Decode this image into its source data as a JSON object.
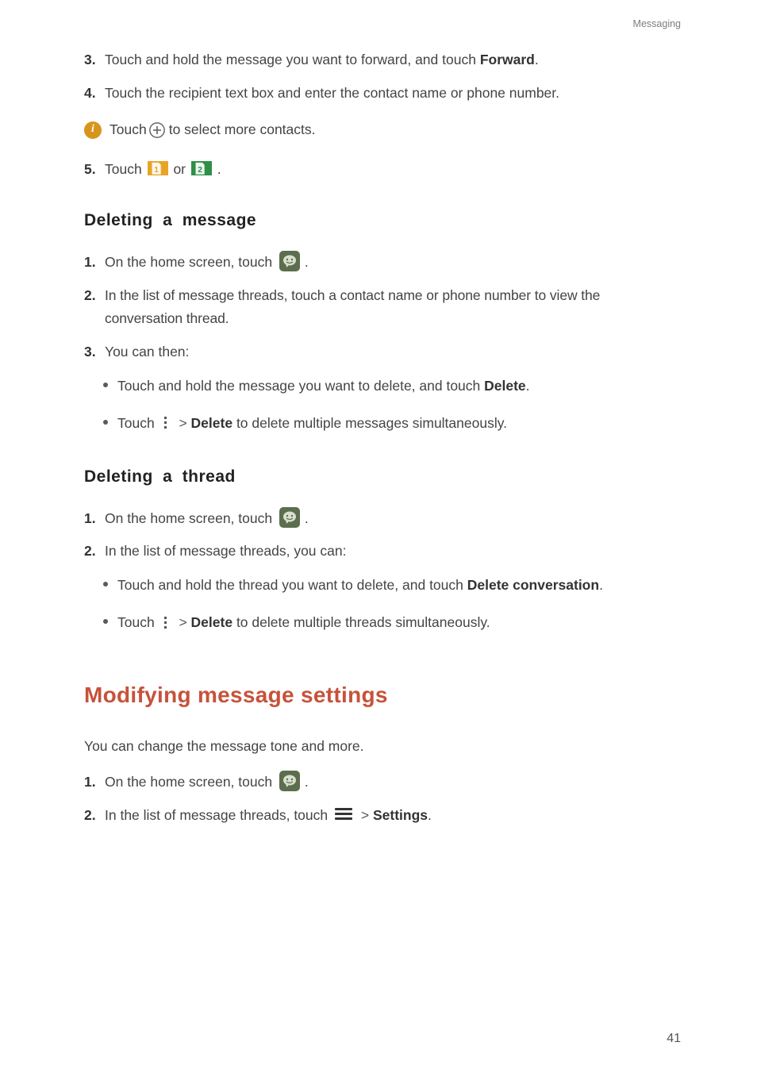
{
  "breadcrumb": "Messaging",
  "cont_steps": {
    "s3": {
      "num": "3.",
      "pre": "Touch and hold the message you want to forward, and touch ",
      "bold": "Forward",
      "post": "."
    },
    "s4": {
      "num": "4.",
      "text": "Touch the recipient text box and enter the contact name or phone number."
    }
  },
  "info_line": {
    "pre": "Touch ",
    "post": "to select more contacts."
  },
  "s5": {
    "num": "5.",
    "pre": "Touch ",
    "mid": "or ",
    "post": "."
  },
  "del_msg": {
    "heading": "Deleting a message",
    "s1": {
      "num": "1.",
      "pre": "On the home screen, touch ",
      "post": "."
    },
    "s2": {
      "num": "2.",
      "text": "In the list of message threads, touch a contact name or phone number to view the conversation thread."
    },
    "s3": {
      "num": "3.",
      "text": "You can then:"
    },
    "b1": {
      "pre": "Touch and hold the message you want to delete, and touch ",
      "bold": "Delete",
      "post": "."
    },
    "b2": {
      "pre": "Touch ",
      "gt": ">",
      "bold": "Delete",
      "post": " to delete multiple messages simultaneously."
    }
  },
  "del_thread": {
    "heading": "Deleting a thread",
    "s1": {
      "num": "1.",
      "pre": "On the home screen, touch ",
      "post": "."
    },
    "s2": {
      "num": "2.",
      "text": "In the list of message threads, you can:"
    },
    "b1": {
      "pre": "Touch and hold the thread you want to delete, and touch ",
      "bold": "Delete conversation",
      "post": "."
    },
    "b2": {
      "pre": "Touch ",
      "gt": ">",
      "bold": "Delete",
      "post": " to delete multiple threads simultaneously."
    }
  },
  "mod_settings": {
    "heading": "Modifying message settings",
    "intro": "You can change the message tone and more.",
    "s1": {
      "num": "1.",
      "pre": "On the home screen, touch ",
      "post": "."
    },
    "s2": {
      "num": "2.",
      "pre": "In the list of message threads, touch ",
      "gt": ">",
      "bold": "Settings",
      "post": "."
    }
  },
  "sim": {
    "one": "1",
    "two": "2"
  },
  "page_number": "41"
}
